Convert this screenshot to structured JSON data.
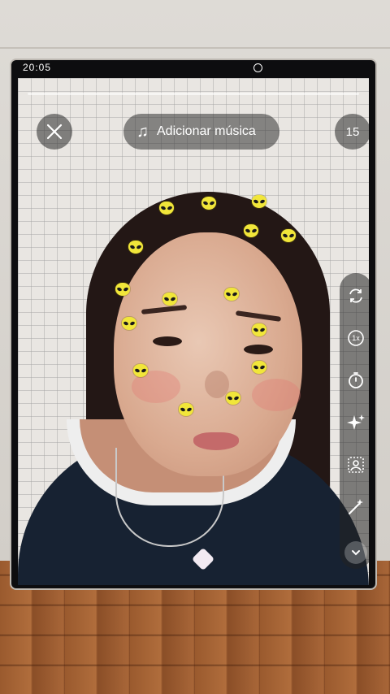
{
  "status_bar": {
    "time": "20:05"
  },
  "header": {
    "music_label": "Adicionar música",
    "timer_value": "15"
  },
  "icons": {
    "close": "close-icon",
    "music": "music-note-icon",
    "flip": "flip-camera-icon",
    "speed": "speed-icon",
    "timer": "timer-icon",
    "beauty": "sparkle-icon",
    "filters": "filters-icon",
    "effects": "magic-wand-icon",
    "more": "chevron-down-icon"
  },
  "toolbar": {
    "speed_label": "1x"
  },
  "colors": {
    "sticker": "#f1e63a",
    "overlay": "rgba(40,40,40,0.55)"
  }
}
